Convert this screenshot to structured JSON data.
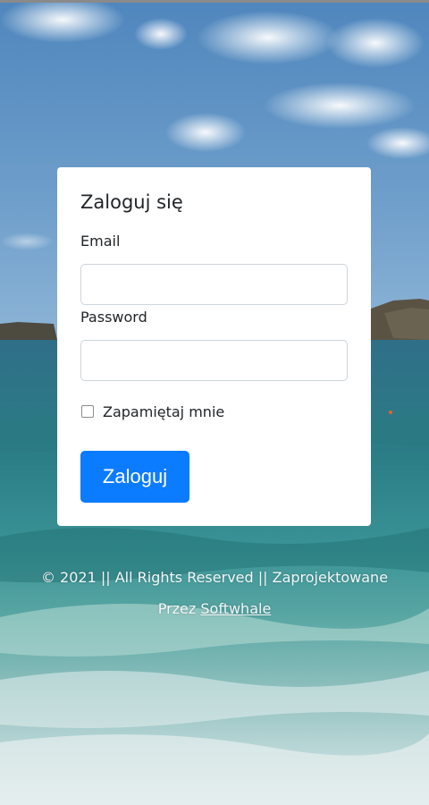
{
  "login": {
    "title": "Zaloguj się",
    "email_label": "Email",
    "email_value": "",
    "password_label": "Password",
    "password_value": "",
    "remember_label": "Zapamiętaj mnie",
    "remember_checked": false,
    "submit_label": "Zaloguj"
  },
  "footer": {
    "line1": "© 2021 || All Rights Reserved || Zaprojektowane",
    "by_text": "Przez",
    "company_link": "Softwhale"
  },
  "colors": {
    "primary_button": "#0b7bff",
    "card_background": "#ffffff",
    "footer_text": "#f2f7f9"
  },
  "background": {
    "icon": "beach-sea-photo"
  }
}
